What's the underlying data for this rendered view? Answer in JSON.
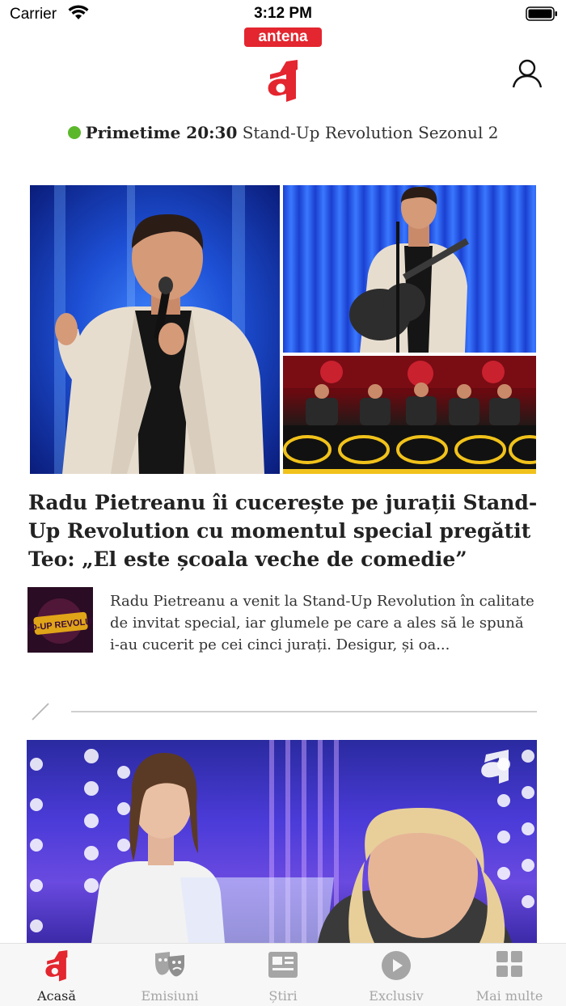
{
  "status_bar": {
    "carrier": "Carrier",
    "time": "3:12 PM"
  },
  "header": {
    "brand": "antena"
  },
  "live": {
    "label": "Primetime 20:30",
    "show": "Stand-Up Revolution Sezonul 2",
    "indicator_color": "#5cb82b"
  },
  "article1": {
    "title": "Radu Pietreanu îi cucerește pe jurații Stand-Up Revolution cu momentul special pregătit Teo: „El este școala veche de comedie”",
    "excerpt": "Radu Pietreanu a venit la Stand-Up Revolution în calitate de invitat special, iar glumele pe care a ales să le spună i-au cucerit pe cei cinci jurați. Desigur, și oa...",
    "thumb_text": "STAND-UP REVOLUTION"
  },
  "tabs": [
    {
      "label": "Acasă",
      "icon": "home-logo-icon",
      "active": true
    },
    {
      "label": "Emisiuni",
      "icon": "theater-masks-icon",
      "active": false
    },
    {
      "label": "Știri",
      "icon": "newspaper-icon",
      "active": false
    },
    {
      "label": "Exclusiv",
      "icon": "play-circle-icon",
      "active": false
    },
    {
      "label": "Mai multe",
      "icon": "grid-icon",
      "active": false
    }
  ],
  "colors": {
    "brand_red": "#e3262f",
    "tab_inactive": "#a5a5a5",
    "tab_active": "#222222"
  }
}
